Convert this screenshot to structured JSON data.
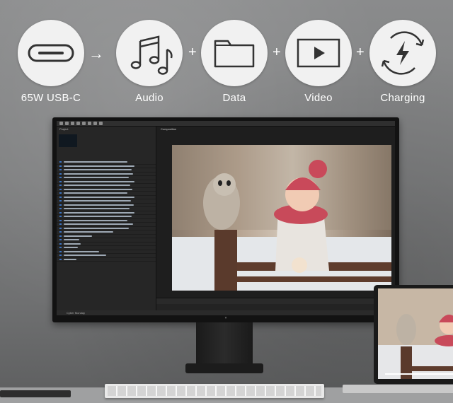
{
  "features": [
    {
      "label": "65W USB-C",
      "icon": "usb-c-port-icon"
    },
    {
      "label": "Audio",
      "icon": "music-notes-icon"
    },
    {
      "label": "Data",
      "icon": "folder-icon"
    },
    {
      "label": "Video",
      "icon": "play-icon"
    },
    {
      "label": "Charging",
      "icon": "charging-bolt-icon"
    }
  ],
  "operators": [
    "→",
    "+",
    "+",
    "+"
  ],
  "app": {
    "panel_project": "Project",
    "panel_composition": "Composition",
    "tab_render": "Cyber Monday"
  },
  "colors": {
    "circle": "#f1f1f1",
    "icon_stroke": "#333333",
    "label": "#ffffff"
  }
}
